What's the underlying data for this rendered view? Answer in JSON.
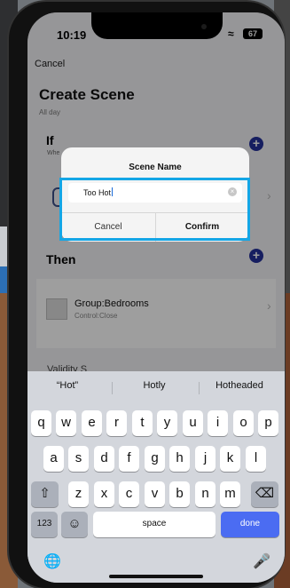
{
  "status": {
    "time": "10:19",
    "battery": "67"
  },
  "nav": {
    "cancel": "Cancel"
  },
  "page": {
    "title": "Create Scene",
    "subtitle": "All day"
  },
  "if_section": {
    "label": "If",
    "when": "Whe"
  },
  "then_section": {
    "label": "Then"
  },
  "action": {
    "title": "Group:Bedrooms",
    "subtitle": "Control:Close"
  },
  "validity": {
    "label": "Validity S"
  },
  "dialog": {
    "title": "Scene Name",
    "input_value": "Too Hot",
    "cancel": "Cancel",
    "confirm": "Confirm"
  },
  "keyboard": {
    "suggestions": [
      "“Hot”",
      "Hotly",
      "Hotheaded"
    ],
    "row1": [
      "q",
      "w",
      "e",
      "r",
      "t",
      "y",
      "u",
      "i",
      "o",
      "p"
    ],
    "row2": [
      "a",
      "s",
      "d",
      "f",
      "g",
      "h",
      "j",
      "k",
      "l"
    ],
    "row3": [
      "z",
      "x",
      "c",
      "v",
      "b",
      "n",
      "m"
    ],
    "numbers": "123",
    "space": "space",
    "done": "done"
  },
  "icons": {
    "shift": "shift-icon",
    "backspace": "backspace-icon",
    "emoji": "emoji-icon",
    "globe": "globe-icon",
    "mic": "microphone-icon"
  },
  "colors": {
    "accent": "#25319b",
    "highlight": "#14a6e6",
    "done_key": "#4b6cf2"
  }
}
